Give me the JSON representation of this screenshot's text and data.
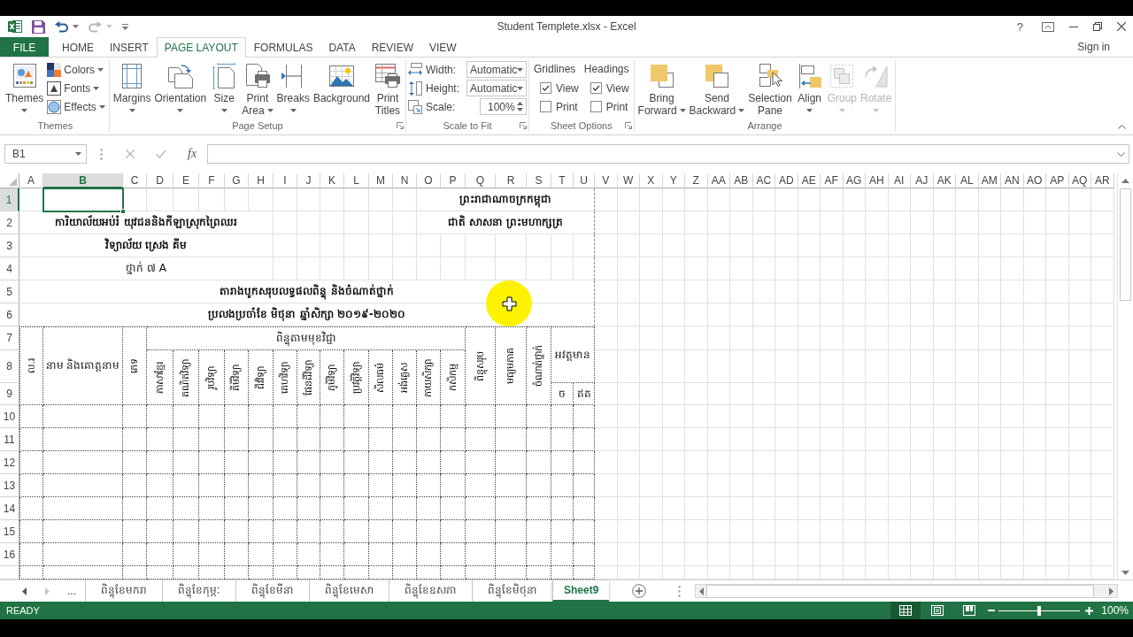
{
  "window": {
    "title": "Student Templete.xlsx - Excel",
    "help": "?"
  },
  "quick_access": [
    {
      "kind": "save",
      "disabled": false
    },
    {
      "kind": "undo",
      "disabled": false
    },
    {
      "kind": "redo",
      "disabled": true
    }
  ],
  "ribbon_tabs": [
    {
      "label": "FILE",
      "kind": "file",
      "selected": false
    },
    {
      "label": "HOME",
      "kind": "tab",
      "selected": false
    },
    {
      "label": "INSERT",
      "kind": "tab",
      "selected": false
    },
    {
      "label": "PAGE LAYOUT",
      "kind": "tab",
      "selected": true
    },
    {
      "label": "FORMULAS",
      "kind": "tab",
      "selected": false
    },
    {
      "label": "DATA",
      "kind": "tab",
      "selected": false
    },
    {
      "label": "REVIEW",
      "kind": "tab",
      "selected": false
    },
    {
      "label": "VIEW",
      "kind": "tab",
      "selected": false
    }
  ],
  "account_link": "Sign in",
  "ribbon": {
    "groups": [
      {
        "name": "Themes",
        "launcher": false,
        "items": [
          {
            "kind": "large",
            "label": "Themes",
            "dropdown": true
          },
          {
            "kind": "small",
            "label": "Colors",
            "dropdown": true
          },
          {
            "kind": "small",
            "label": "Fonts",
            "dropdown": true
          },
          {
            "kind": "small",
            "label": "Effects",
            "dropdown": true
          }
        ]
      },
      {
        "name": "Page Setup",
        "launcher": true,
        "items": [
          {
            "kind": "large",
            "label": "Margins",
            "dropdown": true
          },
          {
            "kind": "large",
            "label": "Orientation",
            "dropdown": true
          },
          {
            "kind": "large",
            "label": "Size",
            "dropdown": true
          },
          {
            "kind": "large",
            "label": "Print Area",
            "dropdown": true
          },
          {
            "kind": "large",
            "label": "Breaks",
            "dropdown": true
          },
          {
            "kind": "large",
            "label": "Background",
            "dropdown": false
          },
          {
            "kind": "large",
            "label": "Print Titles",
            "dropdown": false
          }
        ]
      },
      {
        "name": "Scale to Fit",
        "launcher": true,
        "items": [
          {
            "kind": "select",
            "label": "Width:",
            "value": "Automatic"
          },
          {
            "kind": "select",
            "label": "Height:",
            "value": "Automatic"
          },
          {
            "kind": "spinner",
            "label": "Scale:",
            "value": "100%"
          }
        ]
      },
      {
        "name": "Sheet Options",
        "launcher": true,
        "items": [
          {
            "kind": "checks",
            "label": "Gridlines",
            "checks": [
              {
                "label": "View",
                "checked": true
              },
              {
                "label": "Print",
                "checked": false
              }
            ]
          },
          {
            "kind": "checks",
            "label": "Headings",
            "checks": [
              {
                "label": "View",
                "checked": true
              },
              {
                "label": "Print",
                "checked": false
              }
            ]
          }
        ]
      },
      {
        "name": "Arrange",
        "launcher": false,
        "items": [
          {
            "kind": "large",
            "label": "Bring Forward",
            "dropdown": true,
            "disabled": false
          },
          {
            "kind": "large",
            "label": "Send Backward",
            "dropdown": true,
            "disabled": false
          },
          {
            "kind": "large",
            "label": "Selection Pane",
            "dropdown": false,
            "disabled": false
          },
          {
            "kind": "large",
            "label": "Align",
            "dropdown": true,
            "disabled": false
          },
          {
            "kind": "large",
            "label": "Group",
            "dropdown": true,
            "disabled": true
          },
          {
            "kind": "large",
            "label": "Rotate",
            "dropdown": true,
            "disabled": true
          }
        ]
      }
    ]
  },
  "formula_bar": {
    "name_box": "B1",
    "function_label": "fx"
  },
  "sheet": {
    "columns": [
      {
        "label": "A",
        "selected": false
      },
      {
        "label": "B",
        "selected": true
      },
      {
        "label": "C",
        "selected": false
      },
      {
        "label": "D",
        "selected": false
      },
      {
        "label": "E",
        "selected": false
      },
      {
        "label": "F",
        "selected": false
      },
      {
        "label": "G",
        "selected": false
      },
      {
        "label": "H",
        "selected": false
      },
      {
        "label": "I",
        "selected": false
      },
      {
        "label": "J",
        "selected": false
      },
      {
        "label": "K",
        "selected": false
      },
      {
        "label": "L",
        "selected": false
      },
      {
        "label": "M",
        "selected": false
      },
      {
        "label": "N",
        "selected": false
      },
      {
        "label": "O",
        "selected": false
      },
      {
        "label": "P",
        "selected": false
      },
      {
        "label": "Q",
        "selected": false
      },
      {
        "label": "R",
        "selected": false
      },
      {
        "label": "S",
        "selected": false
      },
      {
        "label": "T",
        "selected": false
      },
      {
        "label": "U",
        "selected": false
      },
      {
        "label": "V",
        "selected": false
      },
      {
        "label": "W",
        "selected": false
      },
      {
        "label": "X",
        "selected": false
      },
      {
        "label": "Y",
        "selected": false
      },
      {
        "label": "Z",
        "selected": false
      },
      {
        "label": "AA",
        "selected": false
      },
      {
        "label": "AB",
        "selected": false
      },
      {
        "label": "AC",
        "selected": false
      },
      {
        "label": "AD",
        "selected": false
      },
      {
        "label": "AE",
        "selected": false
      },
      {
        "label": "AF",
        "selected": false
      },
      {
        "label": "AG",
        "selected": false
      },
      {
        "label": "AH",
        "selected": false
      },
      {
        "label": "AI",
        "selected": false
      },
      {
        "label": "AJ",
        "selected": false
      },
      {
        "label": "AK",
        "selected": false
      },
      {
        "label": "AL",
        "selected": false
      },
      {
        "label": "AM",
        "selected": false
      },
      {
        "label": "AN",
        "selected": false
      },
      {
        "label": "AO",
        "selected": false
      },
      {
        "label": "AP",
        "selected": false
      },
      {
        "label": "AQ",
        "selected": false
      },
      {
        "label": "AR",
        "selected": false
      }
    ],
    "rows": [
      {
        "label": "1",
        "selected": true
      },
      {
        "label": "2",
        "selected": false
      },
      {
        "label": "3",
        "selected": false
      },
      {
        "label": "4",
        "selected": false
      },
      {
        "label": "5",
        "selected": false
      },
      {
        "label": "6",
        "selected": false
      },
      {
        "label": "7",
        "selected": false
      },
      {
        "label": "8",
        "selected": false
      },
      {
        "label": "9",
        "selected": false
      },
      {
        "label": "10",
        "selected": false
      },
      {
        "label": "11",
        "selected": false
      },
      {
        "label": "12",
        "selected": false
      },
      {
        "label": "13",
        "selected": false
      },
      {
        "label": "14",
        "selected": false
      },
      {
        "label": "15",
        "selected": false
      },
      {
        "label": "16",
        "selected": false
      }
    ],
    "cells": [
      {
        "text": "ព្រះរាជាណាចក្រកម្ពុជា",
        "bold": true,
        "rotated": false
      },
      {
        "text": "ការិយាល័យអប់រំ យុវជននិងកីឡាស្រុកព្រៃឈរ",
        "bold": true,
        "rotated": false
      },
      {
        "text": "ជាតិ សាសនា ព្រះមហាក្សត្រ",
        "bold": true,
        "rotated": false
      },
      {
        "text": "វិទ្យាល័យ ស្រេង គីម",
        "bold": true,
        "rotated": false
      },
      {
        "text": "ថ្នាក់ ៧ A",
        "bold": false,
        "rotated": false
      },
      {
        "text": "តារាងបូកសរុបលទ្ធផលពិន្ទុ និងចំណាត់ថ្នាក់",
        "bold": true,
        "rotated": false
      },
      {
        "text": "ប្រលងប្រចាំខែ មិថុនា ឆ្នាំសិក្សា ២០១៩-២០២០",
        "bold": true,
        "rotated": false
      },
      {
        "text": "ល.រ",
        "bold": false,
        "rotated": true
      },
      {
        "text": "នាម និងគោត្តនាម",
        "bold": false,
        "rotated": false
      },
      {
        "text": "ភេទ",
        "bold": false,
        "rotated": true
      },
      {
        "text": "ពិន្ទុតាមមុខវិជ្ជា",
        "bold": false,
        "rotated": false
      },
      {
        "text": "ភាសាខ្មែរ",
        "bold": false,
        "rotated": true
      },
      {
        "text": "គណិតវិទ្យា",
        "bold": false,
        "rotated": true
      },
      {
        "text": "រូបវិទ្យា",
        "bold": false,
        "rotated": true
      },
      {
        "text": "គីមីវិទ្យា",
        "bold": false,
        "rotated": true
      },
      {
        "text": "ជីវវិទ្យា",
        "bold": false,
        "rotated": true
      },
      {
        "text": "គេហវិទ្យា",
        "bold": false,
        "rotated": true
      },
      {
        "text": "ផែនដីវិទ្យា",
        "bold": false,
        "rotated": true
      },
      {
        "text": "ភូមិវិទ្យា",
        "bold": false,
        "rotated": true
      },
      {
        "text": "ប្រវត្តិវិទ្យា",
        "bold": false,
        "rotated": true
      },
      {
        "text": "សីលធម៌",
        "bold": false,
        "rotated": true
      },
      {
        "text": "អង់គ្លេស",
        "bold": false,
        "rotated": true
      },
      {
        "text": "កាយសិក្សា",
        "bold": false,
        "rotated": true
      },
      {
        "text": "កសិកម្ម",
        "bold": false,
        "rotated": true
      },
      {
        "text": "ពិន្ទុសរុប",
        "bold": false,
        "rotated": true
      },
      {
        "text": "មធ្យមភាគ",
        "bold": false,
        "rotated": true
      },
      {
        "text": "ចំណាត់ថ្នាក់",
        "bold": false,
        "rotated": true
      },
      {
        "text": "អវត្តមាន",
        "bold": false,
        "rotated": false
      },
      {
        "text": "ច",
        "bold": false,
        "rotated": false
      },
      {
        "text": "ឥត",
        "bold": false,
        "rotated": false
      }
    ]
  },
  "sheet_tabs": {
    "nav": [
      {
        "disabled": false
      },
      {
        "disabled": true
      }
    ],
    "overflow": "...",
    "tabs": [
      {
        "label": "ពិន្ទុខែមករា",
        "selected": false
      },
      {
        "label": "ពិន្ទុខែកុម្ភៈ",
        "selected": false
      },
      {
        "label": "ពិន្ទុខែមីនា",
        "selected": false
      },
      {
        "label": "ពិន្ទុខែមេសា",
        "selected": false
      },
      {
        "label": "ពិន្ទុខែឧសភា",
        "selected": false
      },
      {
        "label": "ពិន្ទុខែមិថុនា",
        "selected": false
      },
      {
        "label": "Sheet9",
        "selected": true
      }
    ]
  },
  "status_bar": {
    "mode": "READY",
    "views": [
      {
        "selected": true
      },
      {
        "selected": false
      },
      {
        "selected": false
      }
    ],
    "zoom": {
      "level": 0.5,
      "reading": "100%"
    }
  }
}
